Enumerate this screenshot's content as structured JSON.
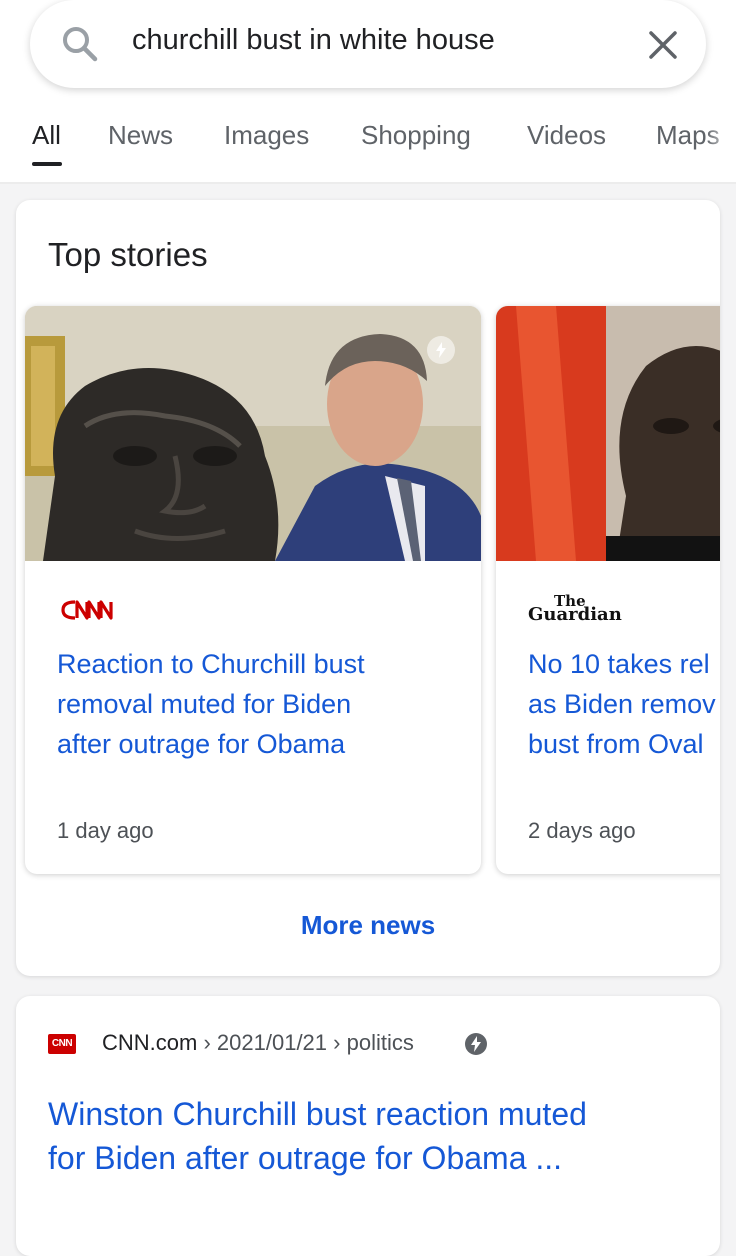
{
  "search": {
    "query": "churchill bust in white house"
  },
  "tabs": [
    {
      "label": "All"
    },
    {
      "label": "News"
    },
    {
      "label": "Images"
    },
    {
      "label": "Shopping"
    },
    {
      "label": "Videos"
    },
    {
      "label": "Maps"
    }
  ],
  "top_stories": {
    "title": "Top stories",
    "stories": [
      {
        "source": "CNN",
        "headline": "Reaction to Churchill bust\nremoval muted for Biden\nafter outrage for Obama",
        "time": "1 day ago"
      },
      {
        "source": "The Guardian",
        "headline": "No 10 takes rel\nas Biden remov\nbust from Oval",
        "time": "2 days ago"
      }
    ],
    "more_label": "More news"
  },
  "result": {
    "favicon": "CNN",
    "site": "CNN.com",
    "date": "2021/01/21",
    "section": "politics",
    "title": "Winston Churchill bust reaction muted\nfor Biden after outrage for Obama ..."
  },
  "colors": {
    "link": "#1558d6",
    "cnn_red": "#cc0000"
  }
}
